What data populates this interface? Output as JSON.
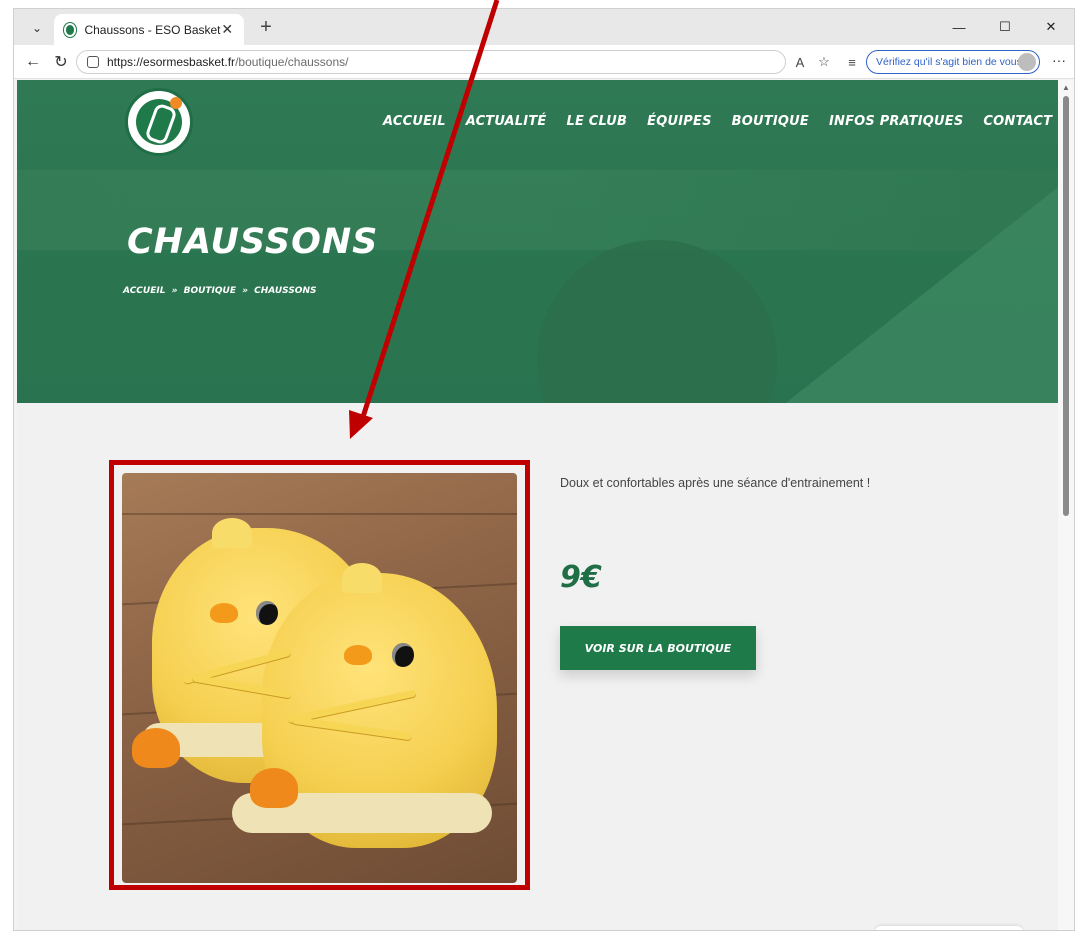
{
  "browser": {
    "tab_title": "Chaussons - ESO Basket",
    "url_host": "https://esormesbasket.fr",
    "url_path": "/boutique/chaussons/",
    "verify_text": "Vérifiez qu'il s'agit bien de vous",
    "icons": [
      "tab-list-icon",
      "site-favicon-icon",
      "close-icon",
      "new-tab-icon",
      "minimize-icon",
      "maximize-icon",
      "close-window-icon",
      "back-icon",
      "refresh-icon",
      "lock-icon",
      "read-aloud-icon",
      "favorite-star-icon",
      "favorites-icon",
      "more-icon"
    ]
  },
  "site": {
    "nav": [
      "ACCUEIL",
      "ACTUALITÉ",
      "LE CLUB",
      "ÉQUIPES",
      "BOUTIQUE",
      "INFOS PRATIQUES",
      "CONTACT"
    ],
    "page_title": "CHAUSSONS",
    "breadcrumb": [
      "ACCUEIL",
      "»",
      "BOUTIQUE",
      "»",
      "CHAUSSONS"
    ]
  },
  "product": {
    "description": "Doux et confortables après une séance d'entrainement !",
    "price": "9€",
    "cta_label": "VOIR SUR LA BOUTIQUE"
  },
  "colors": {
    "brand_green": "#1f7a4a",
    "annotation_red": "#c00000",
    "verify_blue": "#2e63c7"
  }
}
